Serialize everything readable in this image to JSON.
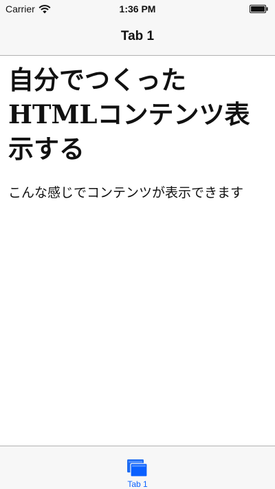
{
  "status_bar": {
    "carrier": "Carrier",
    "time": "1:36 PM",
    "icons": [
      "wifi-icon",
      "battery-icon"
    ]
  },
  "nav_bar": {
    "title": "Tab 1"
  },
  "content": {
    "heading": "自分でつくったHTMLコンテンツ表示する",
    "body_text": "こんな感じでコンテンツが表示できます"
  },
  "tab_bar": {
    "items": [
      {
        "label": "Tab 1",
        "icon": "tab-windows-icon",
        "selected": true
      }
    ],
    "accent_color": "#0a60ff"
  }
}
